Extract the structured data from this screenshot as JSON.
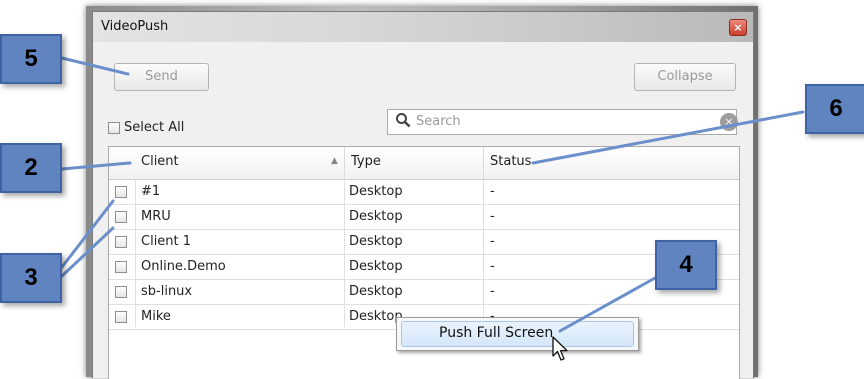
{
  "window": {
    "title": "VideoPush",
    "close_glyph": "×"
  },
  "toolbar": {
    "send_label": "Send",
    "collapse_label": "Collapse"
  },
  "select_all": {
    "label": "Select All"
  },
  "search": {
    "placeholder": "Search",
    "icon": "magnifier",
    "clear_glyph": "×"
  },
  "columns": {
    "client": "Client",
    "type": "Type",
    "status": "Status",
    "sort_glyph": "▲"
  },
  "rows": [
    {
      "client": "#1",
      "type": "Desktop",
      "status": "-"
    },
    {
      "client": "MRU",
      "type": "Desktop",
      "status": "-"
    },
    {
      "client": "Client 1",
      "type": "Desktop",
      "status": "-"
    },
    {
      "client": "Online.Demo",
      "type": "Desktop",
      "status": "-"
    },
    {
      "client": "sb-linux",
      "type": "Desktop",
      "status": "-"
    },
    {
      "client": "Mike",
      "type": "Desktop",
      "status": "-"
    }
  ],
  "context_menu": {
    "items": [
      "Push Full Screen"
    ]
  },
  "callouts": {
    "c5": "5",
    "c2": "2",
    "c3": "3",
    "c6": "6",
    "c4": "4"
  },
  "colors": {
    "callout_fill": "#5f84c0",
    "callout_border": "#3e64a6"
  }
}
